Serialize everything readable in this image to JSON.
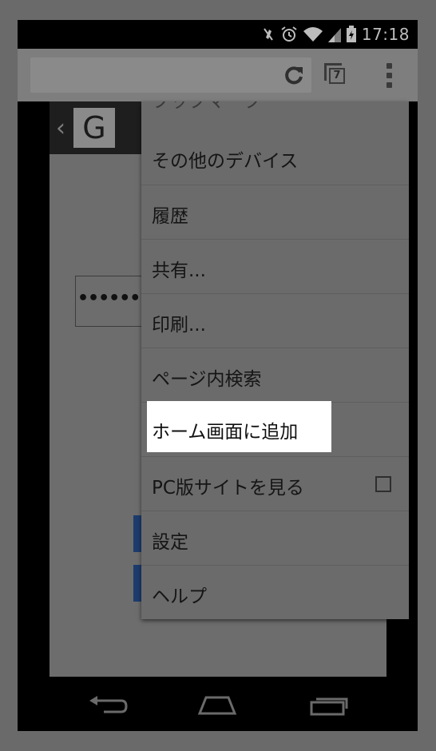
{
  "status_bar": {
    "time": "17:18",
    "icons": [
      "mute-icon",
      "alarm-icon",
      "wifi-icon",
      "signal-icon",
      "battery-charging-icon"
    ]
  },
  "toolbar": {
    "url_value": "",
    "tab_count": "7",
    "icons": [
      "reload-icon",
      "tab-switcher-icon",
      "overflow-menu-icon"
    ]
  },
  "page": {
    "logo_letter": "G",
    "back_glyph": "‹",
    "password_mask": "••••••••••"
  },
  "menu": {
    "items": [
      {
        "label": "ブックマーク"
      },
      {
        "label": "その他のデバイス"
      },
      {
        "label": "履歴"
      },
      {
        "label": "共有..."
      },
      {
        "label": "印刷..."
      },
      {
        "label": "ページ内検索"
      },
      {
        "label": "ホーム画面に追加"
      },
      {
        "label": "PC版サイトを見る",
        "checked": false
      },
      {
        "label": "設定"
      },
      {
        "label": "ヘルプ"
      }
    ]
  },
  "colors": {
    "overlay": "#6a6a6a",
    "highlight": "#ffffff",
    "accent_blue": "#1d3c6e"
  }
}
